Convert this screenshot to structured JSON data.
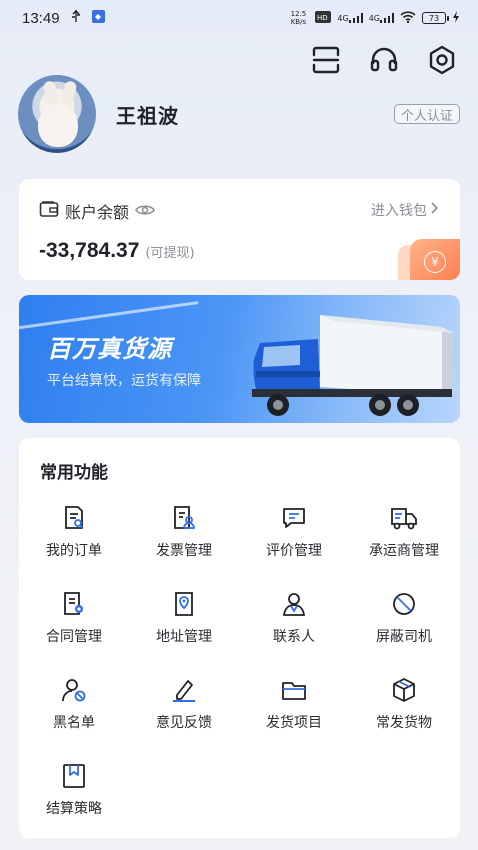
{
  "status_bar": {
    "time": "13:49",
    "net_speed": "12.5 KB/s",
    "network_1": "4G",
    "network_2": "4G",
    "battery": "73"
  },
  "profile": {
    "username": "王祖波",
    "cert_label": "个人认证"
  },
  "balance": {
    "title": "账户余额",
    "wallet_link": "进入钱包",
    "amount": "-33,784.37",
    "hint": "(可提现)",
    "coin_symbol": "¥"
  },
  "banner": {
    "title": "百万真货源",
    "subtitle": "平台结算快，运货有保障"
  },
  "functions": {
    "title": "常用功能",
    "items": [
      {
        "label": "我的订单",
        "icon": "order-icon"
      },
      {
        "label": "发票管理",
        "icon": "invoice-icon"
      },
      {
        "label": "评价管理",
        "icon": "review-icon"
      },
      {
        "label": "承运商管理",
        "icon": "carrier-icon"
      },
      {
        "label": "合同管理",
        "icon": "contract-icon"
      },
      {
        "label": "地址管理",
        "icon": "address-icon"
      },
      {
        "label": "联系人",
        "icon": "contact-icon"
      },
      {
        "label": "屏蔽司机",
        "icon": "block-icon"
      },
      {
        "label": "黑名单",
        "icon": "blacklist-icon"
      },
      {
        "label": "意见反馈",
        "icon": "feedback-icon"
      },
      {
        "label": "发货项目",
        "icon": "project-icon"
      },
      {
        "label": "常发货物",
        "icon": "cargo-icon"
      },
      {
        "label": "结算策略",
        "icon": "settlement-icon"
      }
    ]
  },
  "colors": {
    "accent": "#2f6fe6",
    "orange": "#ff7e52",
    "banner": "#2f7ff0"
  }
}
